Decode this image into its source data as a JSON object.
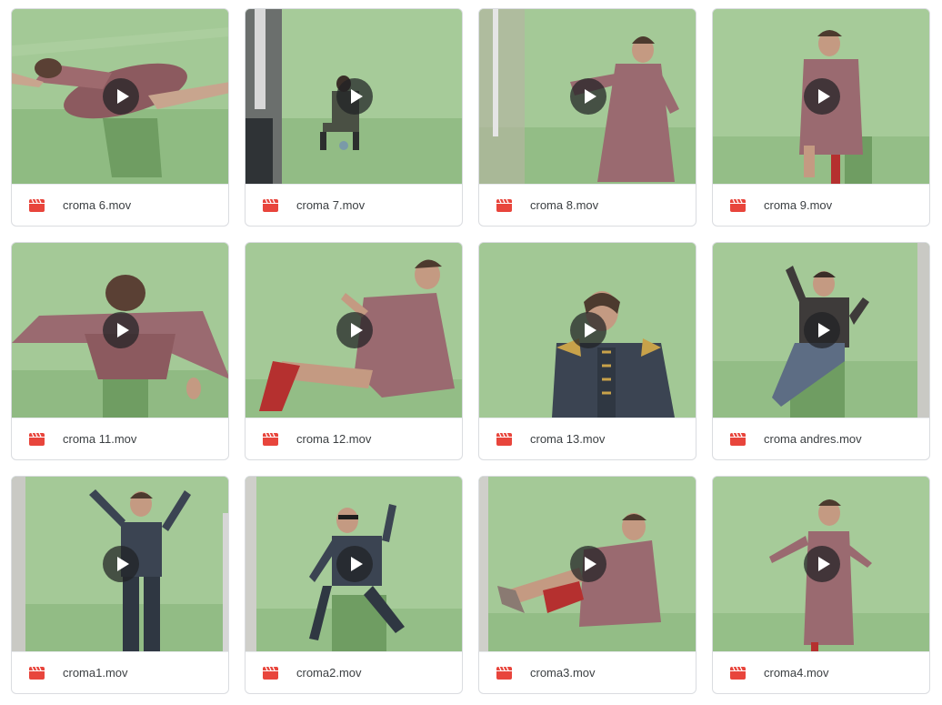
{
  "colors": {
    "file_icon": "#e8453c",
    "play_overlay": "#202124",
    "card_border": "#dadce0",
    "green_screen": "#9cc58d"
  },
  "icons": {
    "file": "video-file-icon",
    "play": "play-icon"
  },
  "files": [
    {
      "name": "croma 6.mov"
    },
    {
      "name": "croma 7.mov"
    },
    {
      "name": "croma 8.mov"
    },
    {
      "name": "croma 9.mov"
    },
    {
      "name": "croma 11.mov"
    },
    {
      "name": "croma 12.mov"
    },
    {
      "name": "croma 13.mov"
    },
    {
      "name": "croma andres.mov"
    },
    {
      "name": "croma1.mov"
    },
    {
      "name": "croma2.mov"
    },
    {
      "name": "croma3.mov"
    },
    {
      "name": "croma4.mov"
    }
  ]
}
